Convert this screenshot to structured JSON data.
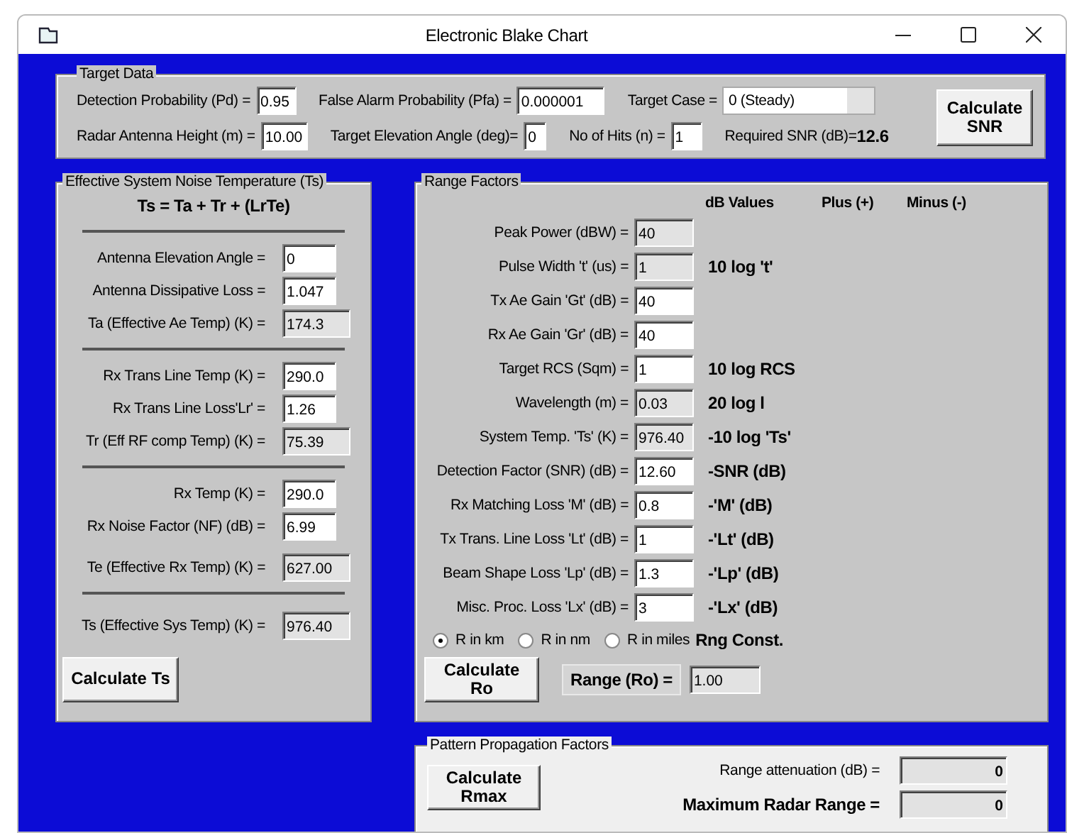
{
  "window": {
    "title": "Electronic Blake Chart"
  },
  "target_data": {
    "title": "Target Data",
    "row_1": [
      {
        "kind": "input",
        "label": "Detection Probability (Pd) =",
        "value": "0.95"
      },
      {
        "kind": "input",
        "label": "False Alarm Probability (Pfa) =",
        "value": "0.000001"
      },
      {
        "kind": "select",
        "label": "Target Case =",
        "value": "0 (Steady)"
      }
    ],
    "row_2": [
      {
        "kind": "input",
        "label": "Radar Antenna Height (m) =",
        "value": "10.00"
      },
      {
        "kind": "input",
        "label": "Target Elevation Angle (deg)=",
        "value": "0"
      },
      {
        "kind": "input",
        "label": "No of Hits (n) =",
        "value": "1"
      },
      {
        "kind": "result",
        "label": "Required SNR (dB)=",
        "value": "12.6"
      }
    ],
    "button": "Calculate SNR"
  },
  "noise_panel": {
    "title": "Effective System Noise Temperature (Ts)",
    "formula": "Ts = Ta + Tr + (LrTe)",
    "groups": [
      [
        {
          "label": "Antenna Elevation Angle =",
          "value": "0",
          "readonly": false
        },
        {
          "label": "Antenna Dissipative Loss =",
          "value": "1.047",
          "readonly": false
        },
        {
          "label": "Ta (Effective Ae Temp) (K) =",
          "value": "174.3",
          "readonly": true
        }
      ],
      [
        {
          "label": "Rx Trans Line Temp (K) =",
          "value": "290.0",
          "readonly": false
        },
        {
          "label": "Rx Trans Line Loss'Lr' =",
          "value": "1.26",
          "readonly": false
        },
        {
          "label": "Tr (Eff RF comp Temp) (K) =",
          "value": "75.39",
          "readonly": true
        }
      ],
      [
        {
          "label": "Rx Temp (K) =",
          "value": "290.0",
          "readonly": false
        },
        {
          "label": "Rx Noise Factor (NF)  (dB) =",
          "value": "6.99",
          "readonly": false
        },
        {
          "label": "Te (Effective Rx Temp) (K) =",
          "value": "627.00",
          "readonly": true
        }
      ],
      [
        {
          "label": "Ts (Effective Sys Temp) (K) =",
          "value": "976.40",
          "readonly": true
        }
      ]
    ],
    "button": "Calculate Ts"
  },
  "range_panel": {
    "title": "Range Factors",
    "headers": [
      "dB Values",
      "Plus (+)",
      "Minus (-)"
    ],
    "rows": [
      {
        "label": "Peak Power (dBW) =",
        "value": "40",
        "readonly": true
      },
      {
        "label": "Pulse Width 't' (us) =",
        "value": "1",
        "readonly": true,
        "db_value": "10 log 't'"
      },
      {
        "label": "Tx Ae Gain 'Gt' (dB) =",
        "value": "40",
        "readonly": false
      },
      {
        "label": "Rx Ae Gain 'Gr' (dB) =",
        "value": "40",
        "readonly": false
      },
      {
        "label": "Target RCS (Sqm) =",
        "value": "1",
        "readonly": false,
        "db_value": "10 log RCS"
      },
      {
        "label": "Wavelength (m) =",
        "value": "0.03",
        "readonly": true,
        "db_value": "20 log l"
      },
      {
        "label": "System Temp. 'Ts' (K) =",
        "value": "976.40",
        "readonly": true,
        "db_value": "-10 log 'Ts'"
      },
      {
        "label": "Detection Factor (SNR) (dB) =",
        "value": "12.60",
        "readonly": false,
        "db_value": "-SNR (dB)"
      },
      {
        "label": "Rx Matching Loss 'M' (dB) =",
        "value": "0.8",
        "readonly": false,
        "db_value": "-'M' (dB)"
      },
      {
        "label": "Tx Trans. Line Loss 'Lt' (dB) =",
        "value": "1",
        "readonly": false,
        "db_value": "-'Lt' (dB)"
      },
      {
        "label": "Beam Shape Loss 'Lp' (dB) =",
        "value": "1.3",
        "readonly": false,
        "db_value": "-'Lp' (dB)"
      },
      {
        "label": "Misc. Proc. Loss 'Lx' (dB) =",
        "value": "3",
        "readonly": false,
        "db_value": "-'Lx' (dB)"
      }
    ],
    "units": [
      {
        "label": "R in km",
        "selected": true
      },
      {
        "label": "R in nm",
        "selected": false
      },
      {
        "label": "R in miles",
        "selected": false
      }
    ],
    "constant_label": "Rng Const.",
    "button": "Calculate Ro",
    "range_label": "Range (Ro) =",
    "range_value": "1.00"
  },
  "pattern_panel": {
    "title": "Pattern Propagation Factors",
    "button": "Calculate Rmax",
    "results": [
      {
        "kind": "plain",
        "label": "Range attenuation (dB) =",
        "value": "0"
      },
      {
        "kind": "strong",
        "label": "Maximum Radar Range =",
        "value": "0"
      }
    ]
  }
}
